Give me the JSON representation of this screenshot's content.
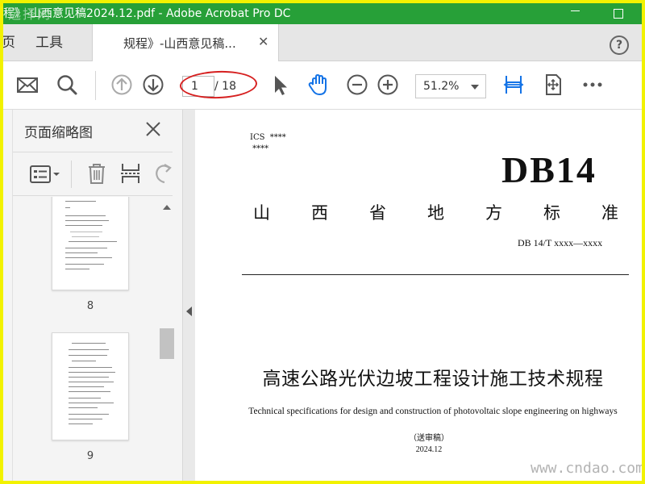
{
  "window": {
    "title": "程》-山西意见稿2024.12.pdf - Adobe Acrobat Pro DC",
    "watermark_top": "选择网"
  },
  "tabs": {
    "home_partial": "页",
    "tools": "工具",
    "document_tab": "规程》-山西意见稿...",
    "close_glyph": "✕",
    "help_glyph": "?"
  },
  "toolbar": {
    "current_page": "1",
    "total_pages": "/ 18",
    "zoom": "51.2%"
  },
  "thumbnails": {
    "title": "页面缩略图",
    "pages": [
      {
        "label": "8"
      },
      {
        "label": "9"
      }
    ]
  },
  "document": {
    "ics_line1": "ICS  ****",
    "ics_line2": " ****",
    "standard_prefix": "DB14",
    "standard_type_chars": [
      "山",
      "西",
      "省",
      "地",
      "方",
      "标",
      "准"
    ],
    "standard_code": "DB 14/T xxxx—xxxx",
    "title_cn": "高速公路光伏边坡工程设计施工技术规程",
    "title_en": "Technical specifications for design and construction of photovoltaic slope engineering on highways",
    "draft_note": "（送审稿）",
    "date": "2024.12"
  },
  "footer": {
    "watermark": "www.cndao.com"
  },
  "colors": {
    "title_bar": "#27a038",
    "accent_blue": "#1473e6",
    "highlight_ellipse": "#d62020",
    "outer_border": "#f2f200"
  }
}
